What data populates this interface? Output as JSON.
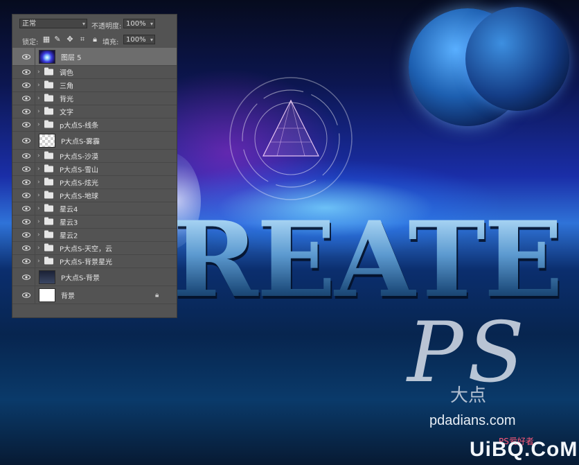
{
  "layers_panel": {
    "blend_mode": "正常",
    "opacity_label": "不透明度:",
    "opacity_value": "100%",
    "lock_label": "锁定:",
    "fill_label": "填充:",
    "fill_value": "100%",
    "lock_icons": [
      "lock-transparent-icon",
      "lock-brush-icon",
      "lock-move-icon",
      "lock-artboard-icon",
      "lock-all-icon"
    ],
    "layers": [
      {
        "name": "图层 5",
        "kind": "pixel",
        "thumb": "nebula",
        "selected": true
      },
      {
        "name": "调色",
        "kind": "group"
      },
      {
        "name": "三角",
        "kind": "group"
      },
      {
        "name": "背光",
        "kind": "group"
      },
      {
        "name": "文字",
        "kind": "group"
      },
      {
        "name": "p大点S-线条",
        "kind": "group"
      },
      {
        "name": "P大点S-雾霾",
        "kind": "pixel",
        "thumb": "transparent"
      },
      {
        "name": "P大点S-沙漠",
        "kind": "group"
      },
      {
        "name": "P大点S-雪山",
        "kind": "group"
      },
      {
        "name": "P大点S-炫光",
        "kind": "group"
      },
      {
        "name": "P大点S-地球",
        "kind": "group"
      },
      {
        "name": "星云4",
        "kind": "group"
      },
      {
        "name": "星云3",
        "kind": "group"
      },
      {
        "name": "星云2",
        "kind": "group"
      },
      {
        "name": "P大点S-天空，云",
        "kind": "group"
      },
      {
        "name": "P大点S-背景星光",
        "kind": "group"
      },
      {
        "name": "P大点S-背景",
        "kind": "pixel",
        "thumb": "dark"
      },
      {
        "name": "背景",
        "kind": "pixel",
        "thumb": "white",
        "locked": true
      }
    ]
  },
  "canvas": {
    "headline": "REATE",
    "watermark_ps": "PS",
    "watermark_brand": "大点",
    "watermark_url": "pdadians.com",
    "site_watermark": "UiBQ.CoM",
    "site_watermark_small": "PS爱好者"
  }
}
